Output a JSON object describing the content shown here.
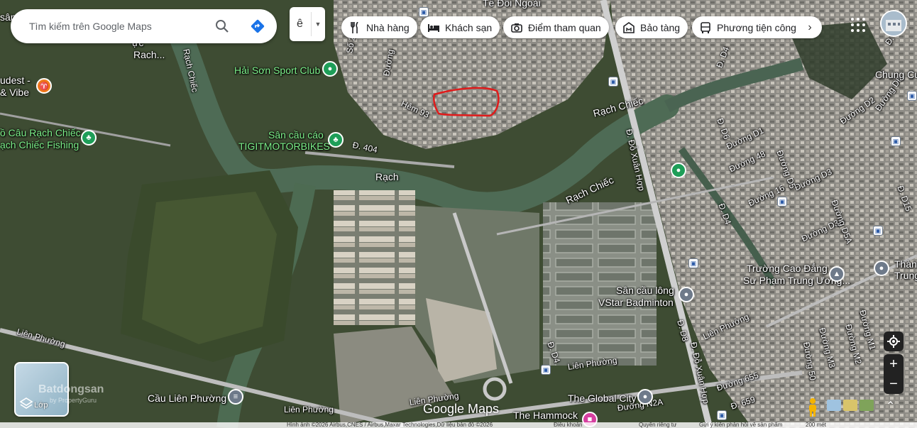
{
  "search": {
    "placeholder": "Tìm kiếm trên Google Maps"
  },
  "language": {
    "value": "ê"
  },
  "chips": [
    {
      "label": "Nhà hàng",
      "icon": "fork-knife-icon"
    },
    {
      "label": "Khách sạn",
      "icon": "bed-icon"
    },
    {
      "label": "Điểm tham quan",
      "icon": "camera-icon"
    },
    {
      "label": "Bảo tàng",
      "icon": "museum-icon"
    },
    {
      "label": "Phương tiện công",
      "icon": "bus-icon"
    }
  ],
  "labels": {
    "te_doi_ngoai": "Tế Đôi Ngoài",
    "rach_top": "Rach...",
    "san_top": "sân",
    "uc_top": "ực",
    "hai_son": "Hải Sơn Sport Club",
    "budest": "udest -",
    "vibe": "& Vibe",
    "o_cau": "ồ Câu Rạch Chiếc",
    "ach_chiec_fishing": "ạch Chiếc Fishing",
    "san_cau": "Sân cầu cáo",
    "tigit": "TIGITMOTORBIKES",
    "rach_chiec_river_v": "Rạch Chiếc",
    "rach_mid": "Rạch",
    "rach_chiec_1": "Rạch Chiếc",
    "rach_chiec_2": "Rạch Chiếc",
    "hem93": "Hẻm 93",
    "duong_so2": "Số 2",
    "duong_top": "Đường",
    "d404": "Đ. 404",
    "do_xuan_hop_1": "Đ. Đỗ Xuân Hợp",
    "do_xuan_hop_2": "Đ. Đỗ Xuân Hợp",
    "d4_a": "Đ. D4",
    "d4_b": "Đ. D4",
    "d4_c": "Đ. D4",
    "d6": "Đ. D6",
    "d8": "Đ. D8",
    "d1": "Đường D1",
    "d48": "Đường 48",
    "d16": "Đường 16",
    "d3": "Đường D3",
    "d5": "Đường D5",
    "d3a": "Đường D3A",
    "d5a": "Đường D5A",
    "d2": "Đường D2",
    "d6b": "Đường D6",
    "d15": "Đ. D15",
    "d10": "Đ. D10",
    "chung_cu": "Chung Cư",
    "truong_cao_dang_1": "Trường Cao Đẳng",
    "truong_cao_dang_2": "Sư Phạm Trung Ương...",
    "than_1": "Thàn",
    "than_2": "Trung",
    "san_cau_long_1": "Sân cầu lông",
    "san_cau_long_2": "VStar Badminton",
    "lien_phuong_1": "Liên Phường",
    "lien_phuong_2": "Liên Phường",
    "lien_phuong_3": "Liên Phường",
    "lien_phuong_4": "Liên Phường",
    "lien_phuong_5": "Liên Phường",
    "cau_lien_phuong": "Cầu Liên Phường",
    "global_city": "The Global City",
    "hammock": "The Hammock",
    "n2a": "Đường N2A",
    "d655": "Đường 655",
    "d659": "Đ. 659",
    "m1": "Đường M1",
    "m2": "Đường M2",
    "m3": "Đường M3",
    "d50": "Đường 50"
  },
  "watermark": {
    "main": "Batdongsan",
    "sub": "by PropertyGuru"
  },
  "layers": {
    "label": "Lớp"
  },
  "google_logo": "Google Maps",
  "footer": {
    "attribution": "Hình ảnh ©2026 Airbus,CNES / Airbus,Maxar Technologies,Dữ liệu bản đồ ©2026",
    "terms": "Điều khoản",
    "privacy": "Quyền riêng tư",
    "feedback": "Gửi ý kiến phản hồi về sản phẩm",
    "scale": "200 mét"
  },
  "colors": {
    "accent": "#1a73e8",
    "marker_green": "#1e9e58",
    "highlight_red": "#e01b1b"
  }
}
